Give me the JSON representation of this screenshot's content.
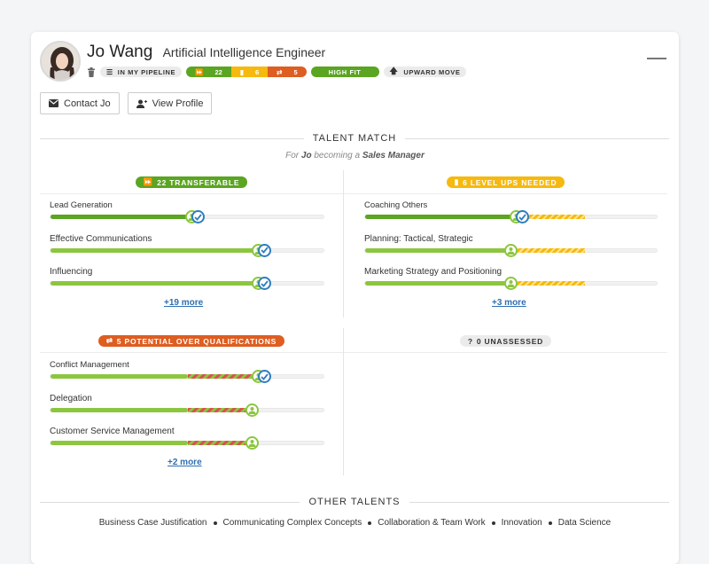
{
  "profile": {
    "name": "Jo Wang",
    "role": "Artificial Intelligence Engineer",
    "pipeline_label": "IN MY PIPELINE",
    "counts": {
      "transferable": "22",
      "level_ups": "6",
      "over_quals": "5"
    },
    "fit_label": "HIGH FIT",
    "move_label": "UPWARD MOVE"
  },
  "actions": {
    "contact_label": "Contact Jo",
    "view_label": "View Profile"
  },
  "talent_match": {
    "heading": "TALENT MATCH",
    "subtitle_prefix": "For ",
    "subtitle_name": "Jo",
    "subtitle_mid": " becoming a ",
    "subtitle_role": "Sales Manager"
  },
  "quadrants": {
    "transferable": {
      "label": "22 TRANSFERABLE",
      "skills": [
        {
          "name": "Lead Generation",
          "level": 0.52,
          "target": 0.52
        },
        {
          "name": "Effective Communications",
          "level": 0.76,
          "target": 0.76
        },
        {
          "name": "Influencing",
          "level": 0.76,
          "target": 0.76
        }
      ],
      "more": "+19 more"
    },
    "level_ups": {
      "label": "6 LEVEL UPS NEEDED",
      "skills": [
        {
          "name": "Coaching Others",
          "level": 0.52,
          "target": 0.75
        },
        {
          "name": "Planning: Tactical, Strategic",
          "level": 0.5,
          "target": 0.75
        },
        {
          "name": "Marketing Strategy and Positioning",
          "level": 0.5,
          "target": 0.75
        }
      ],
      "more": "+3 more"
    },
    "over_quals": {
      "label": "5 POTENTIAL OVER QUALIFICATIONS",
      "skills": [
        {
          "name": "Conflict Management",
          "level": 0.5,
          "target": 0.76
        },
        {
          "name": "Delegation",
          "level": 0.5,
          "target": 0.74
        },
        {
          "name": "Customer Service Management",
          "level": 0.5,
          "target": 0.74
        }
      ],
      "more": "+2 more"
    },
    "unassessed": {
      "label": "0 UNASSESSED"
    }
  },
  "other_talents": {
    "heading": "OTHER TALENTS",
    "items": [
      "Business Case Justification",
      "Communicating Complex Concepts",
      "Collaboration & Team Work",
      "Innovation",
      "Data Science"
    ]
  },
  "colors": {
    "green": "#5aa521",
    "lime": "#8cc63f",
    "yellow": "#f5b90f",
    "orange": "#de5d21",
    "blue": "#2e7dc1",
    "link": "#2e6fb0"
  },
  "icons": [
    "trash-icon",
    "list-icon",
    "forward-icon",
    "bookmark-icon",
    "swap-icon",
    "arrow-up-icon",
    "envelope-icon",
    "user-icon",
    "check-icon",
    "person-icon",
    "question-icon"
  ]
}
